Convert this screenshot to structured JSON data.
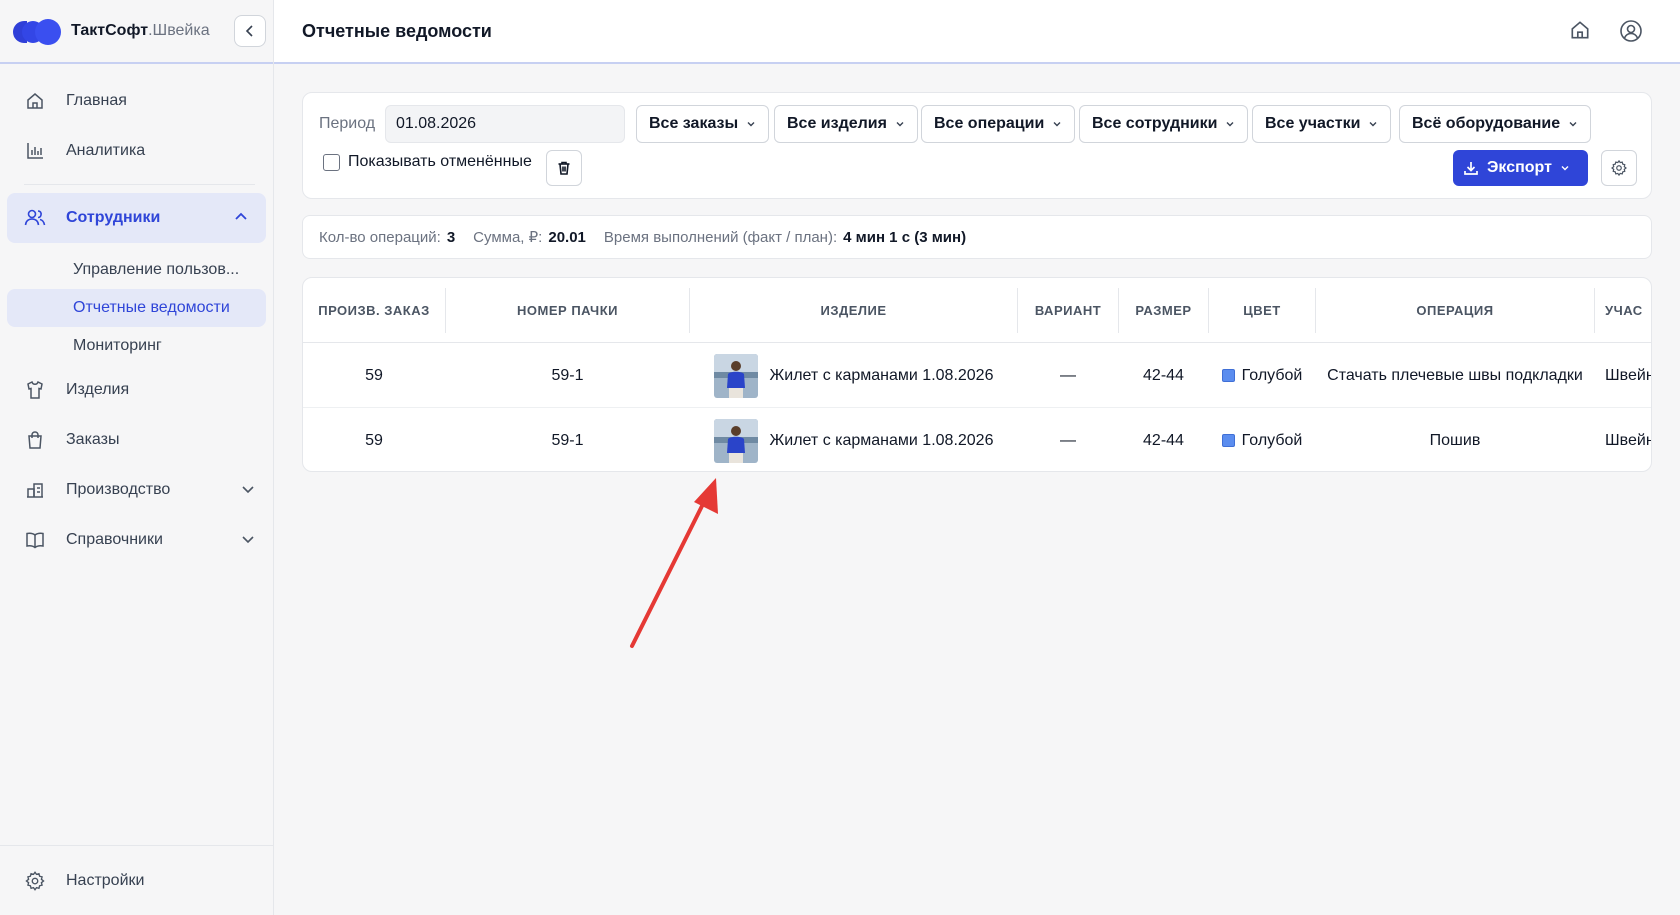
{
  "brand": {
    "name_bold": "ТактСофт",
    "name_light": ".Швейка"
  },
  "colors": {
    "accent": "#2f45d8",
    "swatch_blue": "#5b8def",
    "arrow": "#e53935"
  },
  "sidebar": {
    "items": [
      {
        "label": "Главная",
        "icon": "home-icon"
      },
      {
        "label": "Аналитика",
        "icon": "bar-chart-icon"
      },
      {
        "label": "Сотрудники",
        "icon": "users-icon",
        "expanded": true
      },
      {
        "label": "Изделия",
        "icon": "shirt-icon"
      },
      {
        "label": "Заказы",
        "icon": "shopping-bag-icon"
      },
      {
        "label": "Производство",
        "icon": "factory-icon"
      },
      {
        "label": "Справочники",
        "icon": "book-icon"
      }
    ],
    "sub_items": [
      {
        "label": "Управление пользов..."
      },
      {
        "label": "Отчетные ведомости",
        "active": true
      },
      {
        "label": "Мониторинг"
      }
    ],
    "settings_label": "Настройки"
  },
  "header": {
    "title": "Отчетные ведомости"
  },
  "filters": {
    "period_label": "Период",
    "period_value": "01.08.2026",
    "dropdowns": [
      "Все заказы",
      "Все изделия",
      "Все операции",
      "Все сотрудники",
      "Все участки",
      "Всё оборудование"
    ],
    "show_cancelled_label": "Показывать отменённые",
    "show_cancelled_checked": false,
    "export_label": "Экспорт"
  },
  "summary": {
    "ops_label": "Кол-во операций:",
    "ops_value": "3",
    "sum_label": "Сумма, ₽:",
    "sum_value": "20.01",
    "time_label": "Время выполнений (факт / план):",
    "time_value": "4 мин 1 с (3 мин)"
  },
  "table": {
    "columns": [
      "ПРОИЗВ. ЗАКАЗ",
      "НОМЕР ПАЧКИ",
      "ИЗДЕЛИЕ",
      "ВАРИАНТ",
      "РАЗМЕР",
      "ЦВЕТ",
      "ОПЕРАЦИЯ",
      "УЧАС"
    ],
    "rows": [
      {
        "order": "59",
        "batch": "59-1",
        "product": "Жилет с карманами 1.08.2026",
        "variant": "—",
        "size": "42-44",
        "color": "Голубой",
        "operation": "Стачать плечевые швы подкладки",
        "area": "Швейн"
      },
      {
        "order": "59",
        "batch": "59-1",
        "product": "Жилет с карманами 1.08.2026",
        "variant": "—",
        "size": "42-44",
        "color": "Голубой",
        "operation": "Пошив",
        "area": "Швейн"
      }
    ]
  }
}
